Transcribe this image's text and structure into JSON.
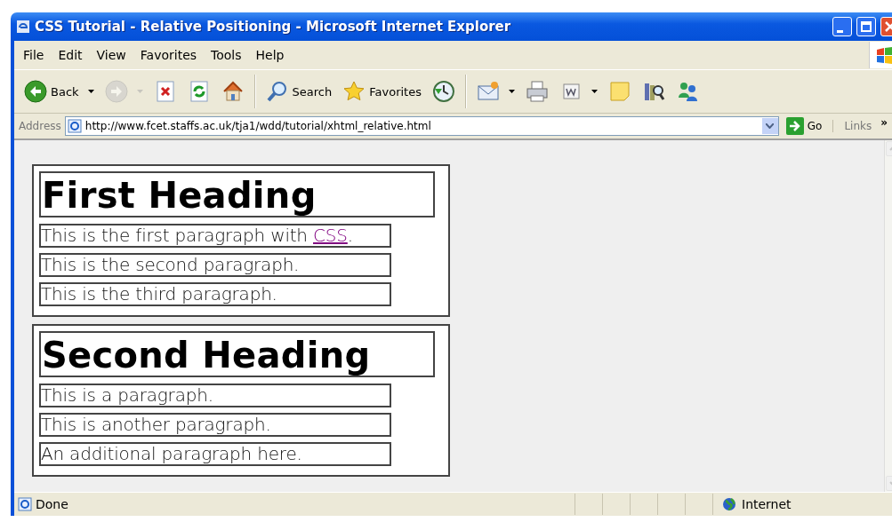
{
  "window": {
    "title": "CSS Tutorial - Relative Positioning - Microsoft Internet Explorer"
  },
  "menu": [
    "File",
    "Edit",
    "View",
    "Favorites",
    "Tools",
    "Help"
  ],
  "toolbar": [
    {
      "kind": "back",
      "label": "Back",
      "dropdown": true,
      "disabled": false
    },
    {
      "kind": "forward",
      "dropdown": true,
      "disabled": true
    },
    {
      "kind": "stop",
      "dropdown": false,
      "disabled": false
    },
    {
      "kind": "refresh",
      "dropdown": false,
      "disabled": false
    },
    {
      "kind": "home",
      "dropdown": false,
      "disabled": false
    },
    {
      "kind": "separator"
    },
    {
      "kind": "search",
      "label": "Search",
      "dropdown": false,
      "disabled": false
    },
    {
      "kind": "favorites",
      "label": "Favorites",
      "dropdown": false,
      "disabled": false
    },
    {
      "kind": "history",
      "dropdown": false,
      "disabled": false
    },
    {
      "kind": "separator"
    },
    {
      "kind": "mail",
      "dropdown": true,
      "disabled": false
    },
    {
      "kind": "print",
      "dropdown": false,
      "disabled": false
    },
    {
      "kind": "edit",
      "dropdown": true,
      "disabled": false
    },
    {
      "kind": "note",
      "dropdown": false,
      "disabled": false
    },
    {
      "kind": "research",
      "dropdown": false,
      "disabled": false
    },
    {
      "kind": "messenger",
      "dropdown": false,
      "disabled": false
    }
  ],
  "address_bar": {
    "label": "Address",
    "value": "http://www.fcet.staffs.ac.uk/tja1/wdd/tutorial/xhtml_relative.html",
    "go": "Go",
    "links": "Links",
    "chevron": "»"
  },
  "page": {
    "sections": [
      {
        "heading": "First Heading",
        "paragraphs": [
          [
            {
              "text": "This is the first paragraph with "
            },
            {
              "text": "CSS",
              "link": true
            },
            {
              "text": "."
            }
          ],
          [
            {
              "text": "This is the second paragraph."
            }
          ],
          [
            {
              "text": "This is the third paragraph."
            }
          ]
        ]
      },
      {
        "heading": "Second Heading",
        "paragraphs": [
          [
            {
              "text": "This is a paragraph."
            }
          ],
          [
            {
              "text": "This is another paragraph."
            }
          ],
          [
            {
              "text": "An additional paragraph here."
            }
          ]
        ]
      }
    ]
  },
  "status_bar": {
    "text": "Done",
    "zone": "Internet"
  }
}
